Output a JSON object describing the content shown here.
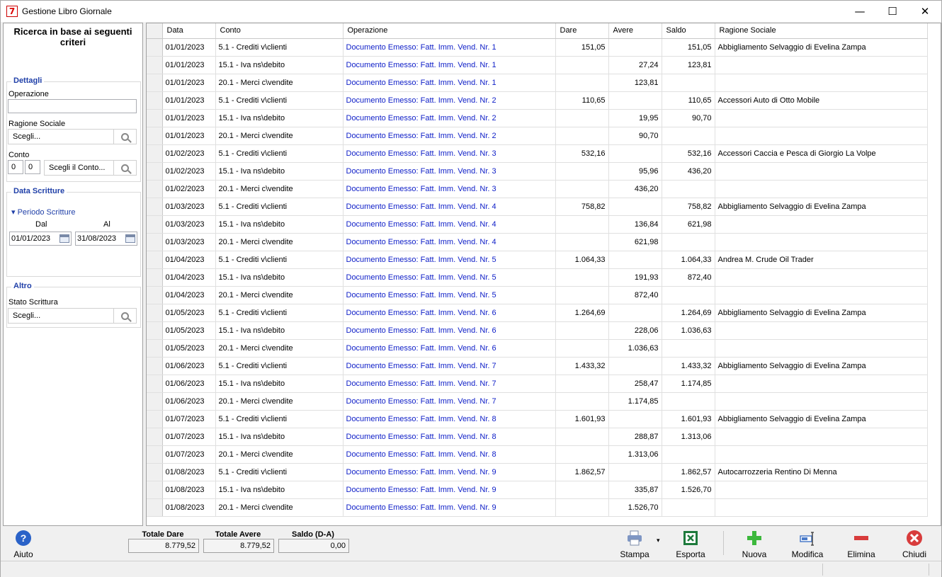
{
  "window": {
    "title": "Gestione Libro Giornale",
    "app_icon": "7",
    "minimize": "—",
    "maximize": "☐",
    "close": "✕"
  },
  "left": {
    "heading": "Ricerca in base ai seguenti criteri",
    "dettagli": {
      "title": "Dettagli",
      "operazione_label": "Operazione",
      "operazione_value": "",
      "ragione_label": "Ragione Sociale",
      "ragione_value": "Scegli...",
      "conto_label": "Conto",
      "conto_a": "0",
      "conto_b": "0",
      "conto_value": "Scegli il Conto..."
    },
    "data": {
      "title": "Data Scritture",
      "periodo": "Periodo Scritture",
      "dal_label": "Dal",
      "al_label": "Al",
      "dal": "01/01/2023",
      "al": "31/08/2023"
    },
    "altro": {
      "title": "Altro",
      "stato_label": "Stato Scrittura",
      "stato_value": "Scegli..."
    }
  },
  "grid": {
    "columns": [
      "Data",
      "Conto",
      "Operazione",
      "Dare",
      "Avere",
      "Saldo",
      "Ragione Sociale"
    ],
    "rows": [
      [
        "01/01/2023",
        "5.1 - Crediti v\\clienti",
        "Documento Emesso: Fatt. Imm. Vend. Nr. 1",
        "151,05",
        "",
        "151,05",
        "Abbigliamento Selvaggio di Evelina Zampa"
      ],
      [
        "01/01/2023",
        "15.1 - Iva ns\\debito",
        "Documento Emesso: Fatt. Imm. Vend. Nr. 1",
        "",
        "27,24",
        "123,81",
        ""
      ],
      [
        "01/01/2023",
        "20.1 - Merci c\\vendite",
        "Documento Emesso: Fatt. Imm. Vend. Nr. 1",
        "",
        "123,81",
        "",
        ""
      ],
      [
        "01/01/2023",
        "5.1 - Crediti v\\clienti",
        "Documento Emesso: Fatt. Imm. Vend. Nr. 2",
        "110,65",
        "",
        "110,65",
        "Accessori Auto di Otto Mobile"
      ],
      [
        "01/01/2023",
        "15.1 - Iva ns\\debito",
        "Documento Emesso: Fatt. Imm. Vend. Nr. 2",
        "",
        "19,95",
        "90,70",
        ""
      ],
      [
        "01/01/2023",
        "20.1 - Merci c\\vendite",
        "Documento Emesso: Fatt. Imm. Vend. Nr. 2",
        "",
        "90,70",
        "",
        ""
      ],
      [
        "01/02/2023",
        "5.1 - Crediti v\\clienti",
        "Documento Emesso: Fatt. Imm. Vend. Nr. 3",
        "532,16",
        "",
        "532,16",
        "Accessori Caccia e Pesca di Giorgio La Volpe"
      ],
      [
        "01/02/2023",
        "15.1 - Iva ns\\debito",
        "Documento Emesso: Fatt. Imm. Vend. Nr. 3",
        "",
        "95,96",
        "436,20",
        ""
      ],
      [
        "01/02/2023",
        "20.1 - Merci c\\vendite",
        "Documento Emesso: Fatt. Imm. Vend. Nr. 3",
        "",
        "436,20",
        "",
        ""
      ],
      [
        "01/03/2023",
        "5.1 - Crediti v\\clienti",
        "Documento Emesso: Fatt. Imm. Vend. Nr. 4",
        "758,82",
        "",
        "758,82",
        "Abbigliamento Selvaggio di Evelina Zampa"
      ],
      [
        "01/03/2023",
        "15.1 - Iva ns\\debito",
        "Documento Emesso: Fatt. Imm. Vend. Nr. 4",
        "",
        "136,84",
        "621,98",
        ""
      ],
      [
        "01/03/2023",
        "20.1 - Merci c\\vendite",
        "Documento Emesso: Fatt. Imm. Vend. Nr. 4",
        "",
        "621,98",
        "",
        ""
      ],
      [
        "01/04/2023",
        "5.1 - Crediti v\\clienti",
        "Documento Emesso: Fatt. Imm. Vend. Nr. 5",
        "1.064,33",
        "",
        "1.064,33",
        "Andrea M. Crude Oil Trader"
      ],
      [
        "01/04/2023",
        "15.1 - Iva ns\\debito",
        "Documento Emesso: Fatt. Imm. Vend. Nr. 5",
        "",
        "191,93",
        "872,40",
        ""
      ],
      [
        "01/04/2023",
        "20.1 - Merci c\\vendite",
        "Documento Emesso: Fatt. Imm. Vend. Nr. 5",
        "",
        "872,40",
        "",
        ""
      ],
      [
        "01/05/2023",
        "5.1 - Crediti v\\clienti",
        "Documento Emesso: Fatt. Imm. Vend. Nr. 6",
        "1.264,69",
        "",
        "1.264,69",
        "Abbigliamento Selvaggio di Evelina Zampa"
      ],
      [
        "01/05/2023",
        "15.1 - Iva ns\\debito",
        "Documento Emesso: Fatt. Imm. Vend. Nr. 6",
        "",
        "228,06",
        "1.036,63",
        ""
      ],
      [
        "01/05/2023",
        "20.1 - Merci c\\vendite",
        "Documento Emesso: Fatt. Imm. Vend. Nr. 6",
        "",
        "1.036,63",
        "",
        ""
      ],
      [
        "01/06/2023",
        "5.1 - Crediti v\\clienti",
        "Documento Emesso: Fatt. Imm. Vend. Nr. 7",
        "1.433,32",
        "",
        "1.433,32",
        "Abbigliamento Selvaggio di Evelina Zampa"
      ],
      [
        "01/06/2023",
        "15.1 - Iva ns\\debito",
        "Documento Emesso: Fatt. Imm. Vend. Nr. 7",
        "",
        "258,47",
        "1.174,85",
        ""
      ],
      [
        "01/06/2023",
        "20.1 - Merci c\\vendite",
        "Documento Emesso: Fatt. Imm. Vend. Nr. 7",
        "",
        "1.174,85",
        "",
        ""
      ],
      [
        "01/07/2023",
        "5.1 - Crediti v\\clienti",
        "Documento Emesso: Fatt. Imm. Vend. Nr. 8",
        "1.601,93",
        "",
        "1.601,93",
        "Abbigliamento Selvaggio di Evelina Zampa"
      ],
      [
        "01/07/2023",
        "15.1 - Iva ns\\debito",
        "Documento Emesso: Fatt. Imm. Vend. Nr. 8",
        "",
        "288,87",
        "1.313,06",
        ""
      ],
      [
        "01/07/2023",
        "20.1 - Merci c\\vendite",
        "Documento Emesso: Fatt. Imm. Vend. Nr. 8",
        "",
        "1.313,06",
        "",
        ""
      ],
      [
        "01/08/2023",
        "5.1 - Crediti v\\clienti",
        "Documento Emesso: Fatt. Imm. Vend. Nr. 9",
        "1.862,57",
        "",
        "1.862,57",
        "Autocarrozzeria Rentino Di Menna"
      ],
      [
        "01/08/2023",
        "15.1 - Iva ns\\debito",
        "Documento Emesso: Fatt. Imm. Vend. Nr. 9",
        "",
        "335,87",
        "1.526,70",
        ""
      ],
      [
        "01/08/2023",
        "20.1 - Merci c\\vendite",
        "Documento Emesso: Fatt. Imm. Vend. Nr. 9",
        "",
        "1.526,70",
        "",
        ""
      ]
    ]
  },
  "totals": {
    "dare_label": "Totale Dare",
    "dare": "8.779,52",
    "avere_label": "Totale Avere",
    "avere": "8.779,52",
    "saldo_label": "Saldo (D-A)",
    "saldo": "0,00"
  },
  "toolbar": {
    "aiuto": "Aiuto",
    "stampa": "Stampa",
    "esporta": "Esporta",
    "nuova": "Nuova",
    "modifica": "Modifica",
    "elimina": "Elimina",
    "chiudi": "Chiudi",
    "help_glyph": "?",
    "dropdown_glyph": "▾"
  },
  "colors": {
    "accent": "#1f3fa8",
    "link": "#1020c8",
    "add": "#3cb83c",
    "delete": "#d83c3c",
    "excel": "#1e7a3c"
  }
}
